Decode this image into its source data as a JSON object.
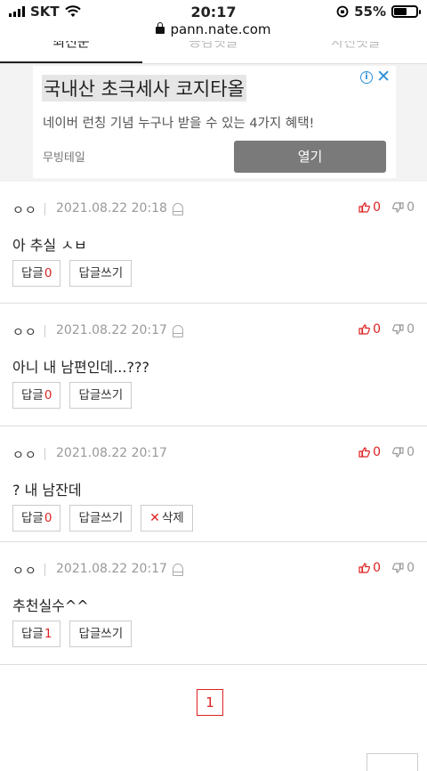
{
  "status": {
    "carrier": "SKT",
    "time": "20:17",
    "battery": "55%",
    "battery_level": 0.55
  },
  "browser": {
    "url": "pann.nate.com"
  },
  "tabs": [
    {
      "label": "최신순",
      "active": true
    },
    {
      "label": "공감댓글",
      "active": false
    },
    {
      "label": "사진댓글",
      "active": false
    }
  ],
  "ad": {
    "title": "국내산 초극세사 코지타올",
    "description": "네이버 런칭 기념 누구나 받을 수 있는 4가지 혜택!",
    "advertiser": "무빙테일",
    "button": "열기",
    "info_icon": "i",
    "close_icon": "✕"
  },
  "comments": [
    {
      "name": "ㅇㅇ",
      "date": "2021.08.22 20:18",
      "text": "아 추실 ㅅㅂ",
      "up": "0",
      "down": "0",
      "reply_label": "답글",
      "reply_count": "0",
      "write_reply": "답글쓰기"
    },
    {
      "name": "ㅇㅇ",
      "date": "2021.08.22 20:17",
      "text": "아니 내 남편인데...???",
      "up": "0",
      "down": "0",
      "reply_label": "답글",
      "reply_count": "0",
      "write_reply": "답글쓰기"
    },
    {
      "name": "ㅇㅇ",
      "date": "2021.08.22 20:17",
      "text": "? 내 남잔데",
      "up": "0",
      "down": "0",
      "reply_label": "답글",
      "reply_count": "0",
      "write_reply": "답글쓰기",
      "delete": "삭제",
      "delete_icon": "✕"
    },
    {
      "name": "ㅇㅇ",
      "date": "2021.08.22 20:17",
      "text": "추천실수^^",
      "up": "0",
      "down": "0",
      "reply_label": "답글",
      "reply_count": "1",
      "write_reply": "답글쓰기"
    }
  ],
  "pagination": {
    "current": "1"
  }
}
